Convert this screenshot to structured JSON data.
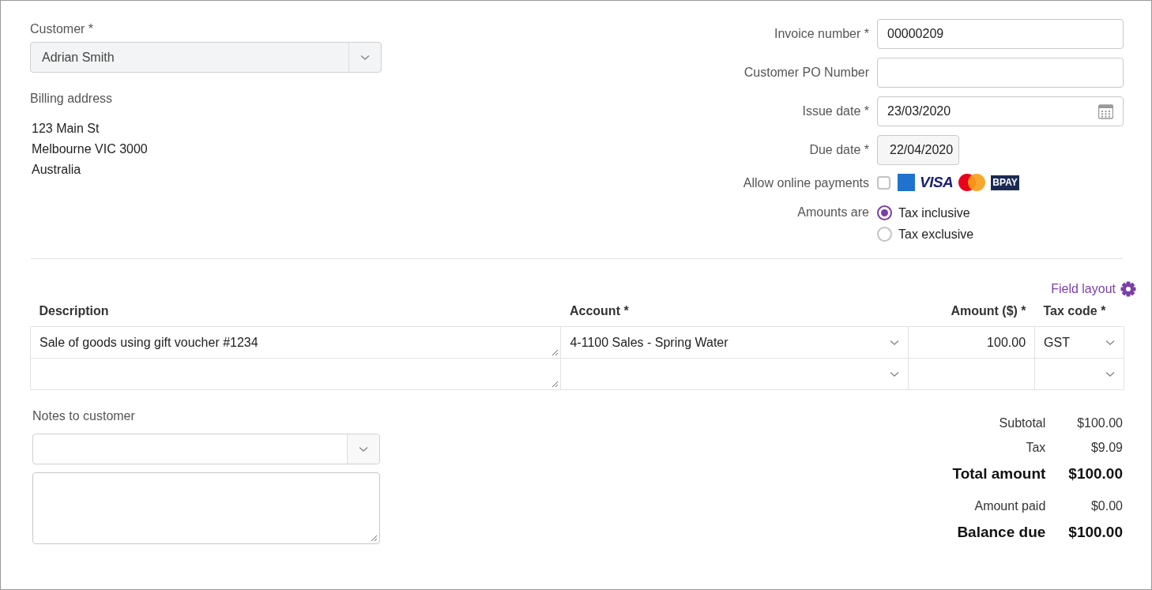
{
  "customer": {
    "label": "Customer *",
    "value": "Adrian Smith",
    "disabled": true
  },
  "billing_address": {
    "label": "Billing address",
    "lines": [
      "123 Main St",
      "Melbourne VIC 3000",
      "Australia"
    ]
  },
  "fields": [
    {
      "kind": "text",
      "label": "Invoice number *",
      "value": "00000209"
    },
    {
      "kind": "text",
      "label": "Customer PO Number"
    },
    {
      "kind": "date",
      "label": "Issue date *",
      "value": "23/03/2020"
    },
    {
      "kind": "short",
      "label": "Due date *",
      "value": "22/04/2020"
    }
  ],
  "online_payments": {
    "label": "Allow online payments",
    "checked": false,
    "logos": [
      {
        "kind": "amex"
      },
      {
        "kind": "visa",
        "text": "VISA"
      },
      {
        "kind": "mastercard"
      },
      {
        "kind": "bpay",
        "text": "BPAY"
      }
    ]
  },
  "amounts_are": {
    "label": "Amounts are",
    "options": [
      {
        "label": "Tax inclusive",
        "selected": true
      },
      {
        "label": "Tax exclusive",
        "selected": false
      }
    ]
  },
  "field_layout_link": "Field layout",
  "table": {
    "columns": [
      "Description",
      "Account *",
      "Amount ($) *",
      "Tax code *"
    ],
    "rows": [
      {
        "description": "Sale of goods using gift voucher #1234",
        "account": "4-1100 Sales - Spring Water",
        "amount": "100.00",
        "tax_code": "GST"
      },
      {}
    ]
  },
  "notes": {
    "label": "Notes to customer"
  },
  "totals": [
    {
      "label": "Subtotal",
      "value": "$100.00",
      "emphasis": false
    },
    {
      "label": "Tax",
      "value": "$9.09",
      "emphasis": false
    },
    {
      "label": "Total amount",
      "value": "$100.00",
      "emphasis": true
    },
    {
      "label": "Amount paid",
      "value": "$0.00",
      "emphasis": false
    },
    {
      "label": "Balance due",
      "value": "$100.00",
      "emphasis": true
    }
  ]
}
